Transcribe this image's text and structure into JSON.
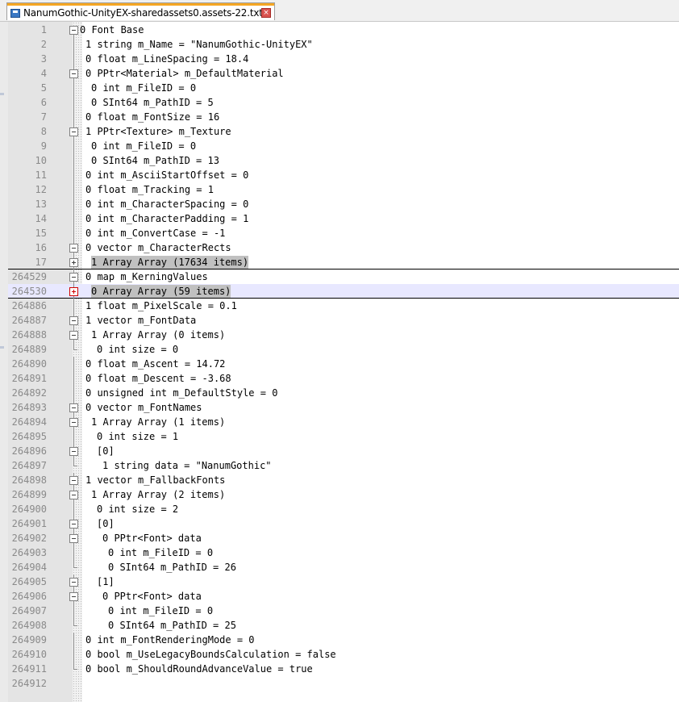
{
  "tab": {
    "title": "NanumGothic-UnityEX-sharedassets0.assets-22.txt",
    "close_glyph": "×",
    "accent_color": "#f5a623"
  },
  "colors": {
    "current_line": "#e8e8ff",
    "collapsed_highlight": "#c0c0c0",
    "line_number": "#8a8a8a",
    "fold_marker_red": "#d00000"
  },
  "lines": [
    {
      "num": "1",
      "text": "0 Font Base",
      "fold": "minus-top",
      "indent": 0
    },
    {
      "num": "2",
      "text": "1 string m_Name = \"NanumGothic-UnityEX\"",
      "fold": "line",
      "indent": 1
    },
    {
      "num": "3",
      "text": "0 float m_LineSpacing = 18.4",
      "fold": "line",
      "indent": 1
    },
    {
      "num": "4",
      "text": "0 PPtr<Material> m_DefaultMaterial",
      "fold": "minus",
      "indent": 1
    },
    {
      "num": "5",
      "text": "0 int m_FileID = 0",
      "fold": "line",
      "indent": 2
    },
    {
      "num": "6",
      "text": "0 SInt64 m_PathID = 5",
      "fold": "line",
      "indent": 2
    },
    {
      "num": "7",
      "text": "0 float m_FontSize = 16",
      "fold": "line",
      "indent": 1
    },
    {
      "num": "8",
      "text": "1 PPtr<Texture> m_Texture",
      "fold": "minus",
      "indent": 1
    },
    {
      "num": "9",
      "text": "0 int m_FileID = 0",
      "fold": "line",
      "indent": 2
    },
    {
      "num": "10",
      "text": "0 SInt64 m_PathID = 13",
      "fold": "line",
      "indent": 2
    },
    {
      "num": "11",
      "text": "0 int m_AsciiStartOffset = 0",
      "fold": "line",
      "indent": 1
    },
    {
      "num": "12",
      "text": "0 float m_Tracking = 1",
      "fold": "line",
      "indent": 1
    },
    {
      "num": "13",
      "text": "0 int m_CharacterSpacing = 0",
      "fold": "line",
      "indent": 1
    },
    {
      "num": "14",
      "text": "0 int m_CharacterPadding = 1",
      "fold": "line",
      "indent": 1
    },
    {
      "num": "15",
      "text": "0 int m_ConvertCase = -1",
      "fold": "line",
      "indent": 1
    },
    {
      "num": "16",
      "text": "0 vector m_CharacterRects",
      "fold": "minus",
      "indent": 1
    },
    {
      "num": "17",
      "text": "1 Array Array (17634 items)",
      "fold": "plus",
      "indent": 2,
      "collapsed": true
    },
    {
      "num": "264529",
      "text": "0 map m_KerningValues",
      "fold": "minus",
      "indent": 1
    },
    {
      "num": "264530",
      "text": "0 Array Array (59 items)",
      "fold": "plus-red",
      "indent": 2,
      "collapsed": true,
      "current": true
    },
    {
      "num": "264886",
      "text": "1 float m_PixelScale = 0.1",
      "fold": "line",
      "indent": 1
    },
    {
      "num": "264887",
      "text": "1 vector m_FontData",
      "fold": "minus",
      "indent": 1
    },
    {
      "num": "264888",
      "text": "1 Array Array (0 items)",
      "fold": "minus",
      "indent": 2
    },
    {
      "num": "264889",
      "text": "0 int size = 0",
      "fold": "end",
      "indent": 3
    },
    {
      "num": "264890",
      "text": "0 float m_Ascent = 14.72",
      "fold": "line",
      "indent": 1
    },
    {
      "num": "264891",
      "text": "0 float m_Descent = -3.68",
      "fold": "line",
      "indent": 1
    },
    {
      "num": "264892",
      "text": "0 unsigned int m_DefaultStyle = 0",
      "fold": "line",
      "indent": 1
    },
    {
      "num": "264893",
      "text": "0 vector m_FontNames",
      "fold": "minus",
      "indent": 1
    },
    {
      "num": "264894",
      "text": "1 Array Array (1 items)",
      "fold": "minus",
      "indent": 2
    },
    {
      "num": "264895",
      "text": "0 int size = 1",
      "fold": "line",
      "indent": 3
    },
    {
      "num": "264896",
      "text": "[0]",
      "fold": "minus",
      "indent": 3
    },
    {
      "num": "264897",
      "text": "1 string data = \"NanumGothic\"",
      "fold": "end",
      "indent": 4
    },
    {
      "num": "264898",
      "text": "1 vector m_FallbackFonts",
      "fold": "minus",
      "indent": 1
    },
    {
      "num": "264899",
      "text": "1 Array Array (2 items)",
      "fold": "minus",
      "indent": 2
    },
    {
      "num": "264900",
      "text": "0 int size = 2",
      "fold": "line",
      "indent": 3
    },
    {
      "num": "264901",
      "text": "[0]",
      "fold": "minus",
      "indent": 3
    },
    {
      "num": "264902",
      "text": "0 PPtr<Font> data",
      "fold": "minus",
      "indent": 4
    },
    {
      "num": "264903",
      "text": "0 int m_FileID = 0",
      "fold": "line",
      "indent": 5
    },
    {
      "num": "264904",
      "text": "0 SInt64 m_PathID = 26",
      "fold": "end",
      "indent": 5
    },
    {
      "num": "264905",
      "text": "[1]",
      "fold": "minus",
      "indent": 3
    },
    {
      "num": "264906",
      "text": "0 PPtr<Font> data",
      "fold": "minus",
      "indent": 4
    },
    {
      "num": "264907",
      "text": "0 int m_FileID = 0",
      "fold": "line",
      "indent": 5
    },
    {
      "num": "264908",
      "text": "0 SInt64 m_PathID = 25",
      "fold": "end",
      "indent": 5
    },
    {
      "num": "264909",
      "text": "0 int m_FontRenderingMode = 0",
      "fold": "line",
      "indent": 1
    },
    {
      "num": "264910",
      "text": "0 bool m_UseLegacyBoundsCalculation = false",
      "fold": "line",
      "indent": 1
    },
    {
      "num": "264911",
      "text": "0 bool m_ShouldRoundAdvanceValue = true",
      "fold": "end",
      "indent": 1
    },
    {
      "num": "264912",
      "text": "",
      "fold": "none",
      "indent": 0
    }
  ]
}
